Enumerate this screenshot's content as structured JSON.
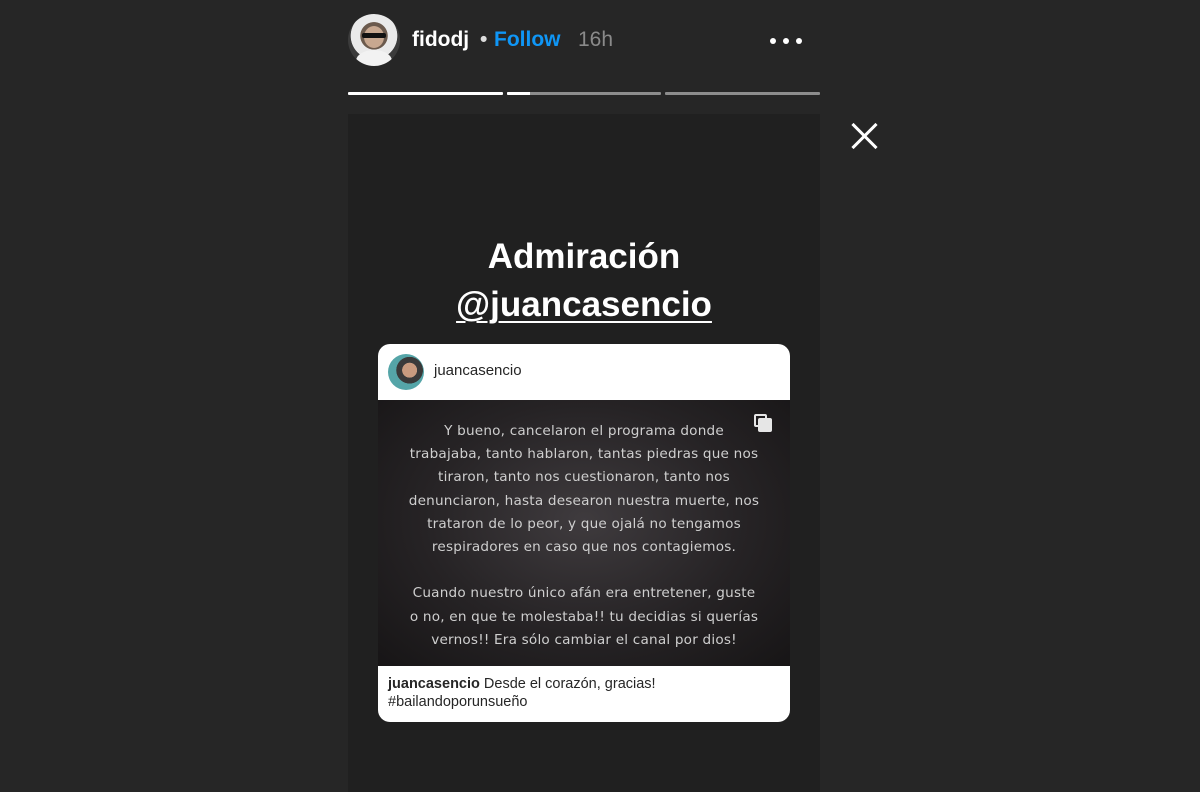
{
  "header": {
    "username": "fidodj",
    "separator": "•",
    "follow_label": "Follow",
    "time": "16h",
    "more_icon": "more-horizontal-icon",
    "avatar_icon": "profile-avatar"
  },
  "progress": {
    "segments": [
      {
        "fill": 1.0
      },
      {
        "fill": 0.15
      },
      {
        "fill": 0.0
      }
    ]
  },
  "close_icon": "close-icon",
  "story": {
    "title": "Admiración",
    "mention": "@juancasencio",
    "post": {
      "username": "juancasencio",
      "multi_icon": "carousel-icon",
      "image_text": "Y bueno, cancelaron el programa donde\ntrabajaba, tanto hablaron, tantas piedras que nos\ntiraron, tanto nos cuestionaron, tanto nos\ndenunciaron, hasta desearon nuestra muerte, nos\ntrataron de lo peor, y que ojalá no tengamos\nrespiradores en caso que nos contagiemos.\n\nCuando nuestro único afán era entretener, guste\no no, en que te molestaba!! tu decidias si querías\nvernos!!   Era sólo cambiar el canal por dios!",
      "caption_user": "juancasencio",
      "caption_text": " Desde el corazón, gracias!",
      "caption_hashtag": "#bailandoporunsueño"
    }
  },
  "colors": {
    "background": "#262626",
    "story_background": "#202020",
    "follow": "#0f96f6",
    "time": "#8a8a8a"
  }
}
